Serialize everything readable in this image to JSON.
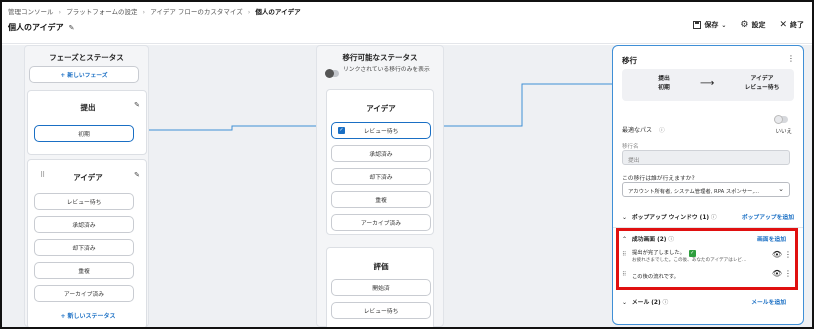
{
  "breadcrumb": [
    {
      "label": "管理コンソール",
      "current": false
    },
    {
      "label": "プラットフォームの設定",
      "current": false
    },
    {
      "label": "アイデア フローのカスタマイズ",
      "current": false
    },
    {
      "label": "個人のアイデア",
      "current": true
    }
  ],
  "header": {
    "title": "個人のアイデア"
  },
  "toolbar": {
    "save": "保存",
    "settings": "設定",
    "close": "終了"
  },
  "left": {
    "title": "フェーズとステータス",
    "new_phase": "+ 新しいフェーズ",
    "phase1": {
      "title": "提出",
      "statuses": [
        "初期"
      ]
    },
    "phase2": {
      "title": "アイデア",
      "statuses": [
        "レビュー待ち",
        "承認済み",
        "却下済み",
        "重複",
        "アーカイブ済み"
      ],
      "new_status": "+ 新しいステータス"
    }
  },
  "middle": {
    "title": "移行可能なステータス",
    "toggle_label": "リンクされている移行のみを表示",
    "group1": {
      "title": "アイデア",
      "statuses": [
        "レビュー待ち",
        "承認済み",
        "却下済み",
        "重複",
        "アーカイブ済み"
      ]
    },
    "group2": {
      "title": "評価",
      "statuses": [
        "開始済",
        "レビュー待ち"
      ]
    }
  },
  "panel": {
    "title": "移行",
    "from_phase": "提出",
    "from_status": "初期",
    "arrow": "⟶",
    "to_phase": "アイデア",
    "to_status": "レビュー待ち",
    "optimal_path_label": "最適なパス",
    "optimal_path_value": "いいえ",
    "transition_name_label": "移行名",
    "transition_name_value": "提出",
    "who_label": "この移行は誰が行えますか?",
    "who_value": "アカウント所有者, システム管理者, RPA スポンサー,...",
    "popup_label": "ポップアップ ウィンドウ (1)",
    "popup_add": "ポップアップを追加",
    "success_label": "成功画面 (2)",
    "success_add": "画面を追加",
    "success_items": [
      {
        "title": "提出が完了しました。",
        "sub": "お疲れさまでした。この後、あなたのアイデアはレビ..."
      },
      {
        "title": "この後の流れです。",
        "sub": ""
      }
    ],
    "mail_label": "メール (2)",
    "mail_add": "メールを追加"
  },
  "colors": {
    "accent": "#1a6fc4",
    "highlight": "#e01010",
    "check": "#2e9e3e"
  }
}
